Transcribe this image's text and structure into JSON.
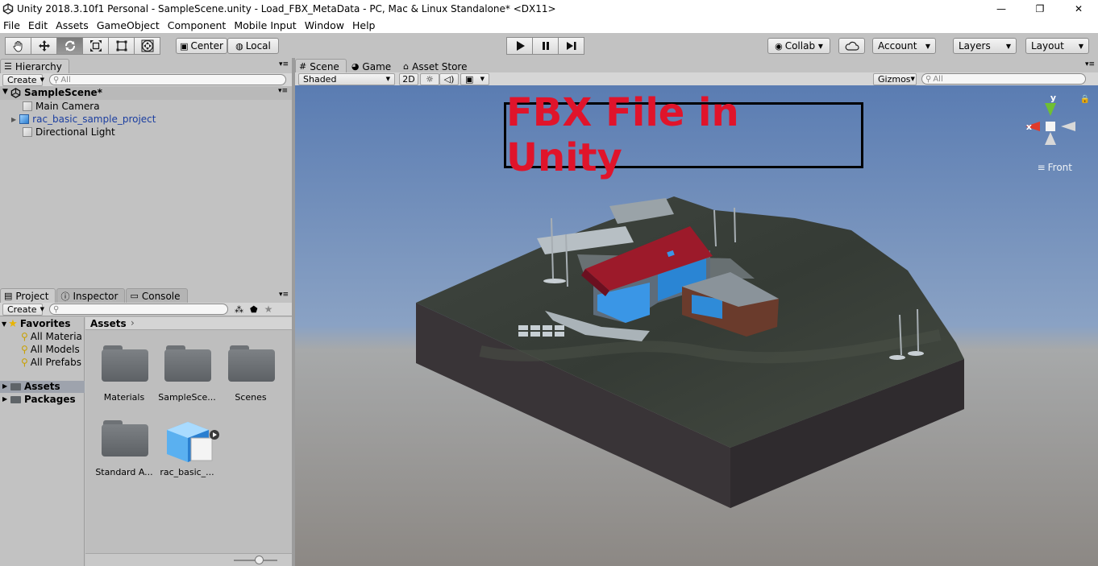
{
  "window": {
    "title": "Unity 2018.3.10f1 Personal - SampleScene.unity - Load_FBX_MetaData - PC, Mac & Linux Standalone* <DX11>",
    "minimize": "—",
    "maximize": "❐",
    "close": "✕"
  },
  "menu": [
    "File",
    "Edit",
    "Assets",
    "GameObject",
    "Component",
    "Mobile Input",
    "Window",
    "Help"
  ],
  "toolbar": {
    "pivot": "Center",
    "space": "Local",
    "collab": "Collab ▾",
    "account": "Account",
    "layers": "Layers",
    "layout": "Layout"
  },
  "hierarchy": {
    "tab": "Hierarchy",
    "create": "Create",
    "search_placeholder": "All",
    "scene": "SampleScene*",
    "items": [
      "Main Camera",
      "rac_basic_sample_project",
      "Directional Light"
    ]
  },
  "project": {
    "tabs": [
      "Project",
      "Inspector",
      "Console"
    ],
    "create": "Create",
    "favorites_label": "Favorites",
    "favorites": [
      "All Materia",
      "All Models",
      "All Prefabs"
    ],
    "roots": [
      "Assets",
      "Packages"
    ],
    "breadcrumb": "Assets",
    "assets": [
      "Materials",
      "SampleSce...",
      "Scenes",
      "Standard A...",
      "rac_basic_..."
    ]
  },
  "scene": {
    "tabs": [
      "Scene",
      "Game",
      "Asset Store"
    ],
    "shading": "Shaded",
    "mode_2d": "2D",
    "gizmos": "Gizmos",
    "search_placeholder": "All",
    "overlay_title": "FBX File in Unity",
    "view_label": "Front",
    "axis_labels": [
      "y",
      "x"
    ]
  },
  "colors": {
    "title_red": "#e0142b",
    "sky_top": "#5c7fb4",
    "ground": "#8f8c87",
    "terrain": "#3b4139",
    "roof": "#9c1a2a",
    "glass": "#2a8fe0"
  }
}
